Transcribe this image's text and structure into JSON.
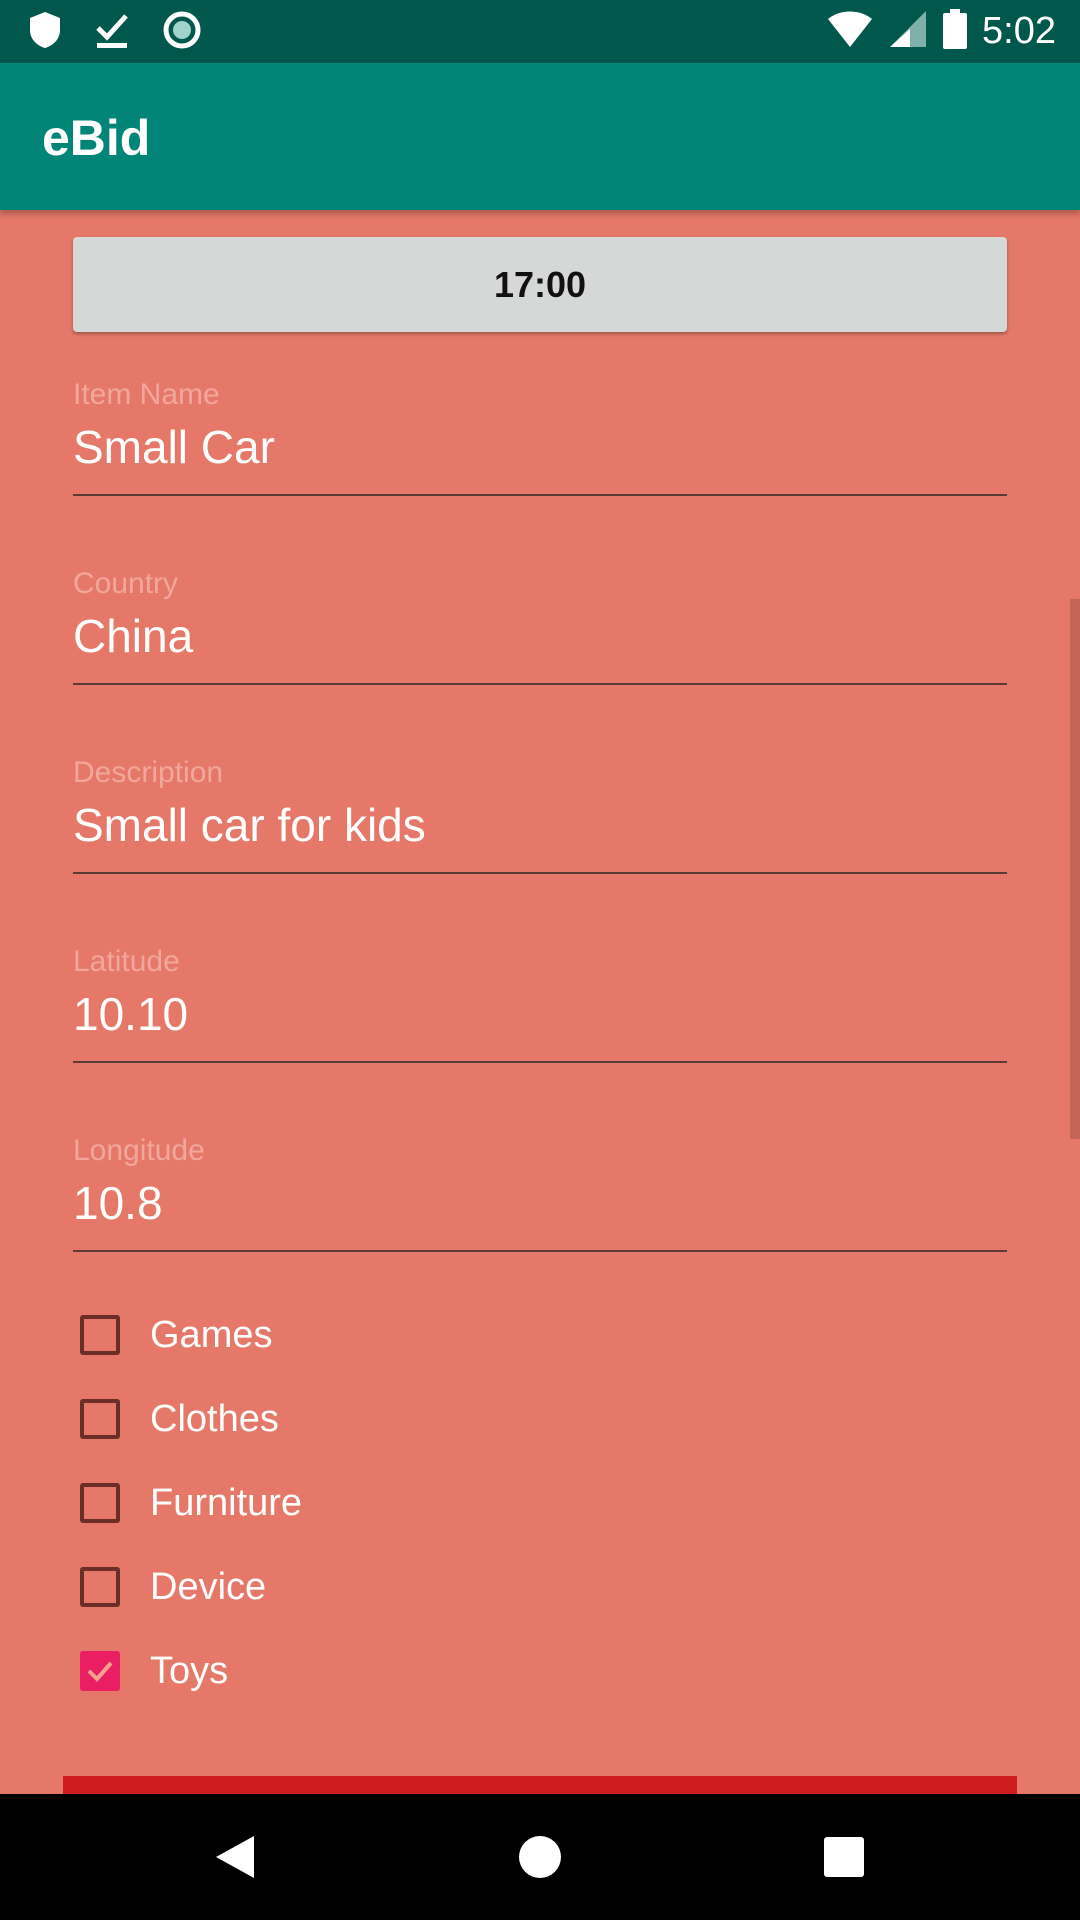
{
  "status_bar": {
    "time": "5:02",
    "icons_left": [
      "shield-icon",
      "download-done-icon",
      "record-icon"
    ],
    "icons_right": [
      "wifi-icon",
      "cell-signal-icon",
      "battery-icon"
    ]
  },
  "app_bar": {
    "title": "eBid"
  },
  "time_button": {
    "label": "17:00"
  },
  "fields": {
    "item_name": {
      "label": "Item Name",
      "value": "Small Car"
    },
    "country": {
      "label": "Country",
      "value": "China"
    },
    "description": {
      "label": "Description",
      "value": "Small car for kids"
    },
    "latitude": {
      "label": "Latitude",
      "value": "10.10"
    },
    "longitude": {
      "label": "Longitude",
      "value": "10.8"
    }
  },
  "categories": [
    {
      "label": "Games",
      "checked": false
    },
    {
      "label": "Clothes",
      "checked": false
    },
    {
      "label": "Furniture",
      "checked": false
    },
    {
      "label": "Device",
      "checked": false
    },
    {
      "label": "Toys",
      "checked": true
    }
  ],
  "colors": {
    "status_bar": "#00574b",
    "app_bar": "#008577",
    "background": "#e57868",
    "accent": "#e91e63",
    "submit_button": "#d01c1c"
  },
  "nav_bar": {
    "icons": [
      "back-icon",
      "home-icon",
      "recents-icon"
    ]
  }
}
